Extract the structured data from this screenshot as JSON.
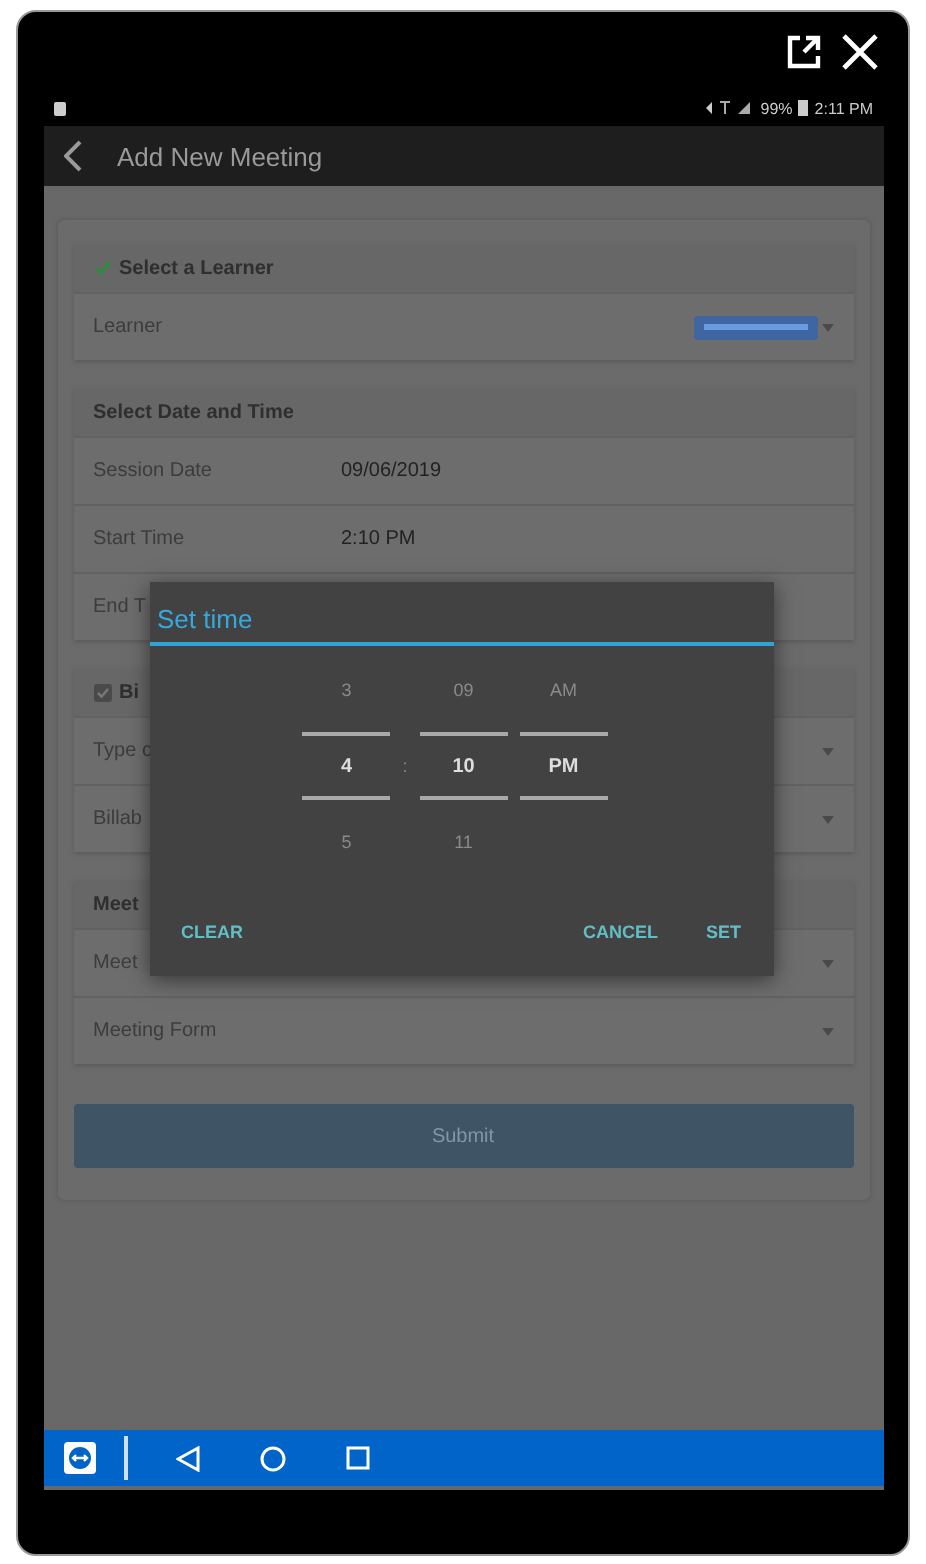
{
  "status_bar": {
    "battery": "99%",
    "time": "2:11 PM"
  },
  "app_bar": {
    "title": "Add New Meeting"
  },
  "sections": [
    {
      "title": "Select a Learner",
      "kind": "status",
      "done": true,
      "rows": [
        {
          "label": "Learner",
          "kind": "select",
          "redacted": true
        }
      ]
    },
    {
      "title": "Select Date and Time",
      "kind": "plain",
      "rows": [
        {
          "label": "Session Date",
          "kind": "value",
          "value": "09/06/2019"
        },
        {
          "label": "Start Time",
          "kind": "value",
          "value": "2:10 PM"
        },
        {
          "label": "End T",
          "kind": "text"
        }
      ]
    },
    {
      "title": "Bi",
      "kind": "checkbox",
      "checked": true,
      "rows": [
        {
          "label": "Type c",
          "kind": "select"
        },
        {
          "label": "Billab",
          "kind": "select"
        }
      ]
    },
    {
      "title": "Meet",
      "kind": "plain",
      "rows": [
        {
          "label": "Meet",
          "kind": "select"
        },
        {
          "label": "Meeting Form",
          "kind": "select"
        }
      ]
    }
  ],
  "submit": {
    "label": "Submit",
    "disabled": true
  },
  "dialog": {
    "title": "Set time",
    "separator": ":",
    "columns": [
      {
        "above": "3",
        "value": "4",
        "below": "5"
      },
      {
        "above": "09",
        "value": "10",
        "below": "11"
      },
      {
        "above": "AM",
        "value": "PM"
      }
    ],
    "buttons": [
      {
        "label": "CLEAR"
      },
      {
        "label": "CANCEL"
      },
      {
        "label": "SET"
      }
    ]
  }
}
